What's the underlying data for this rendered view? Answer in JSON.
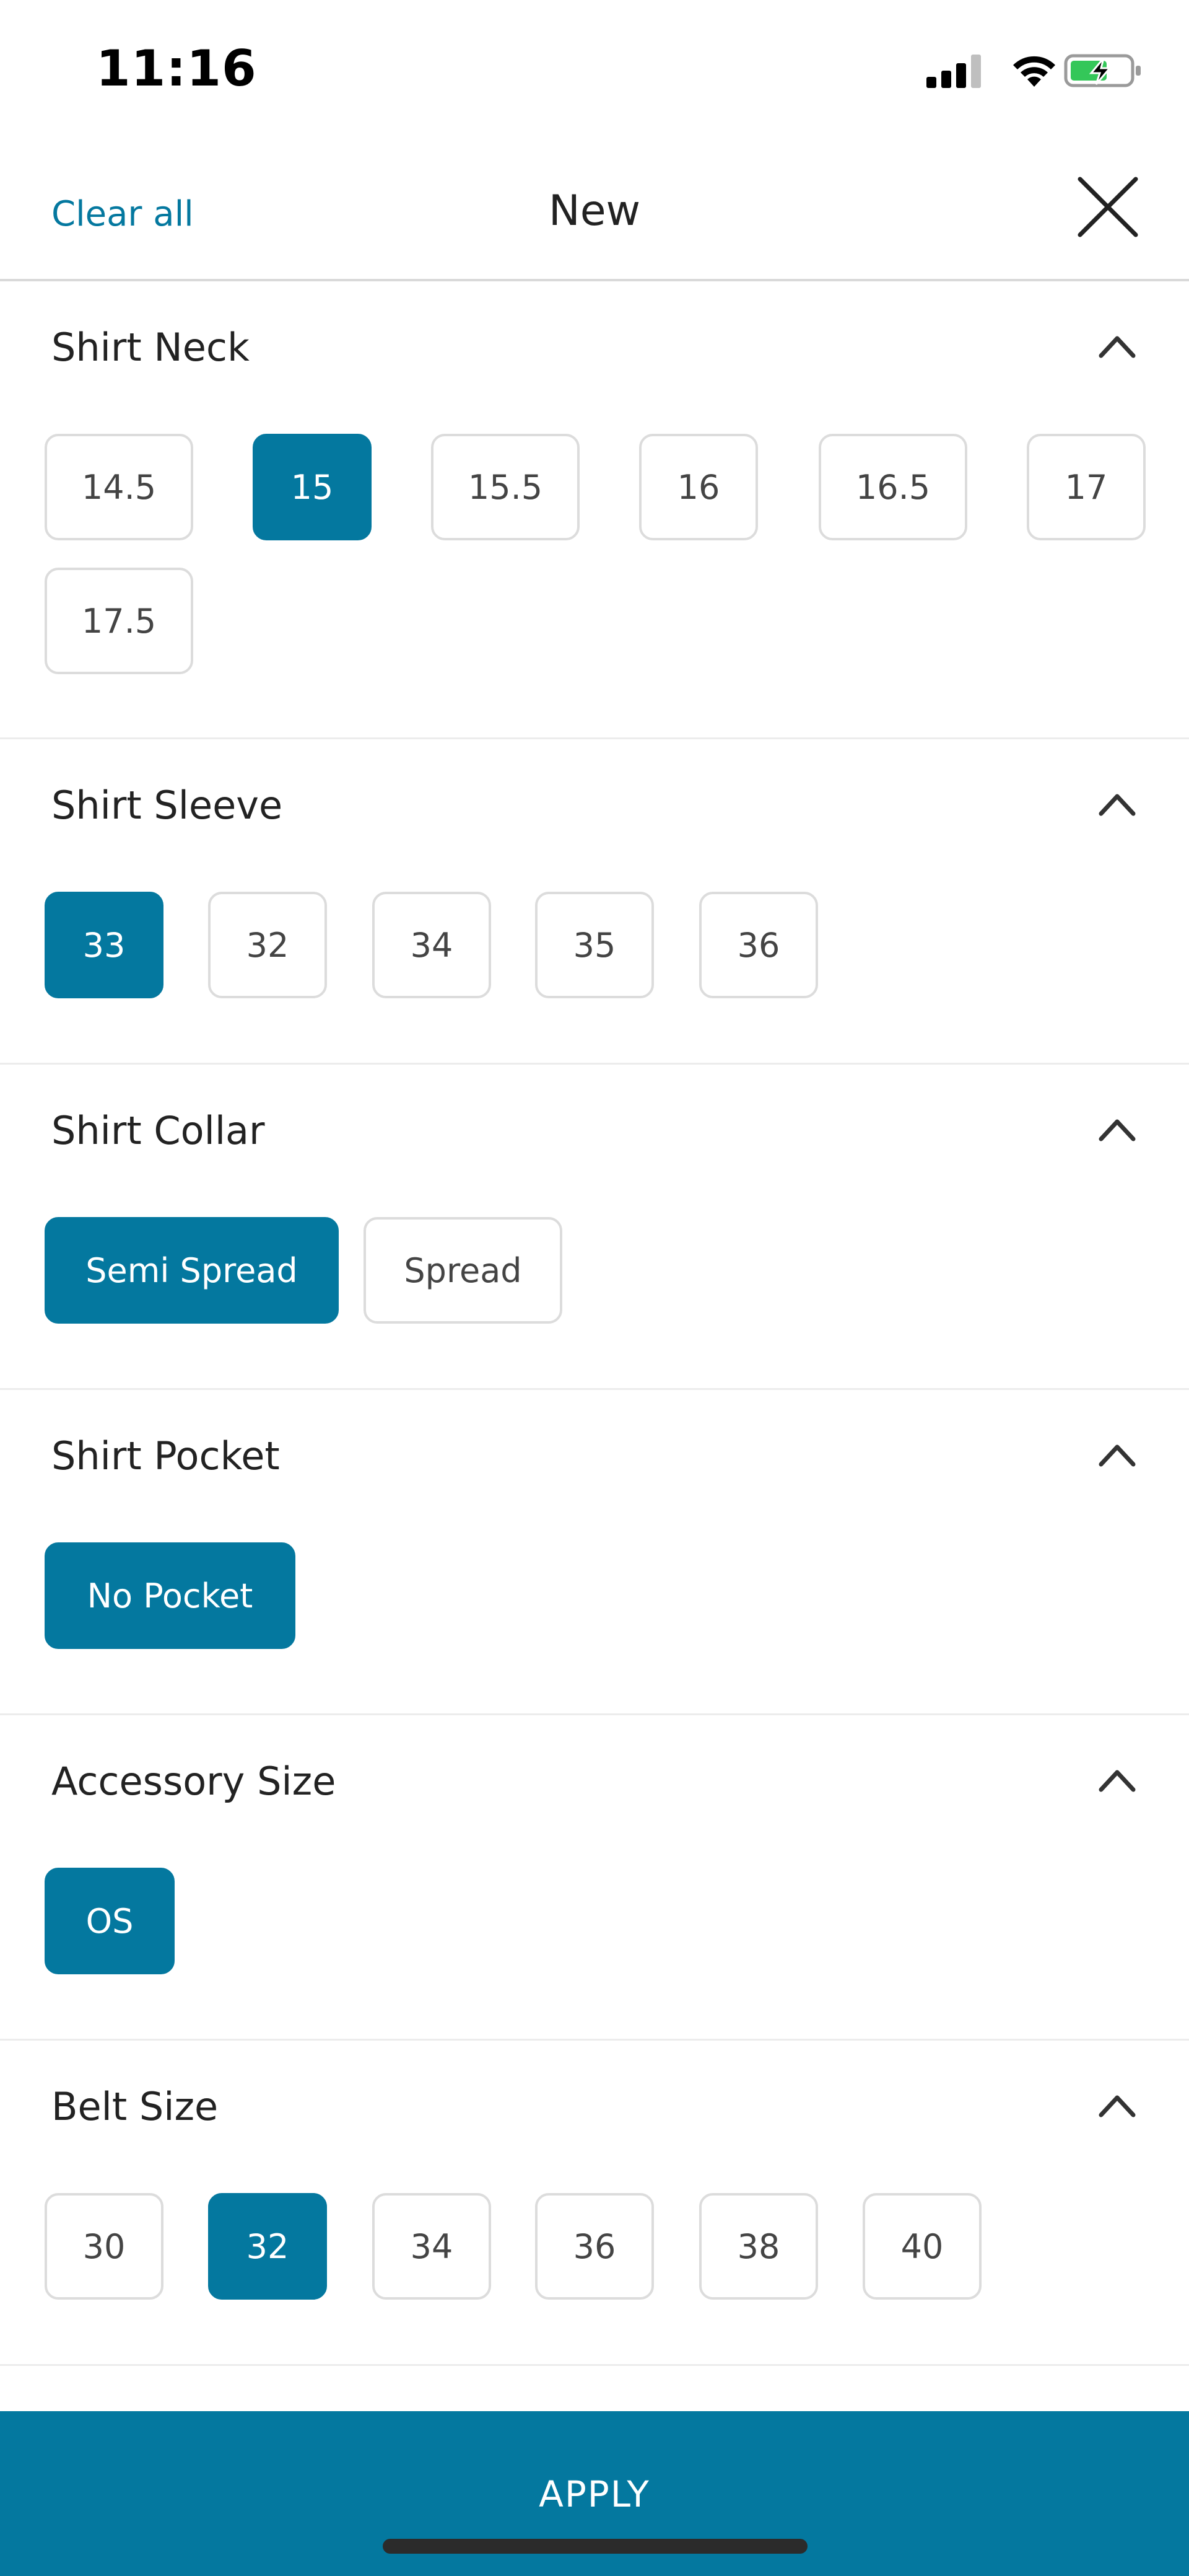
{
  "status_bar": {
    "time": "11:16"
  },
  "header": {
    "clear_all": "Clear all",
    "title": "New"
  },
  "sections": [
    {
      "title": "Shirt Neck",
      "options": [
        "14.5",
        "15",
        "15.5",
        "16",
        "16.5",
        "17",
        "17.5"
      ],
      "selected": "15"
    },
    {
      "title": "Shirt Sleeve",
      "options": [
        "33",
        "32",
        "34",
        "35",
        "36"
      ],
      "selected": "33"
    },
    {
      "title": "Shirt Collar",
      "options": [
        "Semi Spread",
        "Spread"
      ],
      "selected": "Semi Spread"
    },
    {
      "title": "Shirt Pocket",
      "options": [
        "No Pocket"
      ],
      "selected": "No Pocket"
    },
    {
      "title": "Accessory Size",
      "options": [
        "OS"
      ],
      "selected": "OS"
    },
    {
      "title": "Belt Size",
      "options": [
        "30",
        "32",
        "34",
        "36",
        "38",
        "40"
      ],
      "selected": "32"
    }
  ],
  "apply": {
    "label": "APPLY"
  },
  "colors": {
    "accent": "#04789f",
    "chip_border": "#dcdcdc",
    "divider": "#ececec"
  }
}
